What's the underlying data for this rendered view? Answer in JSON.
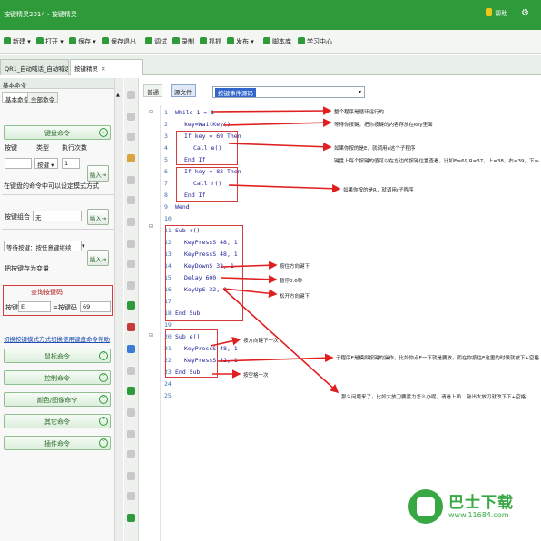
{
  "window": {
    "title": "按键精灵2014 - 按键精灵",
    "vip_label": "帮助",
    "min_icon": "minus-icon",
    "gear_icon": "gear-icon"
  },
  "toolbar": {
    "items": [
      {
        "label": "新建",
        "icon": "new-icon"
      },
      {
        "label": "打开",
        "icon": "open-icon"
      },
      {
        "label": "保存",
        "icon": "save-icon"
      },
      {
        "label": "保存退出",
        "icon": "save-exit-icon"
      },
      {
        "label": "调试",
        "icon": "debug-icon"
      },
      {
        "label": "录制",
        "icon": "record-icon"
      },
      {
        "label": "抓抓",
        "icon": "grab-icon"
      },
      {
        "label": "发布",
        "icon": "publish-icon"
      },
      {
        "label": "脚本库",
        "icon": "library-icon"
      },
      {
        "label": "学习中心",
        "icon": "learn-icon"
      }
    ]
  },
  "tabs": [
    {
      "label": "QR1_自动喊话_自动喊话...",
      "active": false
    },
    {
      "label": "按键精灵",
      "active": true
    }
  ],
  "left_panel": {
    "header": "基本命令",
    "tabs": [
      "基本命令",
      "全部命令"
    ],
    "keyboard_cmd": "键盘命令",
    "key_label": "按键",
    "type_label": "类型",
    "count_label": "执行次数",
    "type_value": "按键",
    "count_value": "1",
    "insert_label": "插入→",
    "hint_text": "在键盘的命令中可以设定模式方式",
    "combo_label": "按键组合",
    "combo_value": "无",
    "wait_label": "等待按键：按任意键继续",
    "sub_label": "把按键存为变量",
    "query_title": "查询按键码",
    "query_key_label": "按键",
    "query_key_value": "E",
    "query_code_label": "=按键码",
    "query_code_value": "69",
    "links": [
      "切换按键模式方式",
      "切换使用键盘命令",
      "帮助"
    ],
    "buttons": [
      "鼠标命令",
      "控制命令",
      "颜色/图像命令",
      "其它命令",
      "插件命令"
    ]
  },
  "editor": {
    "btn_normal": "普通",
    "btn_source": "源文件",
    "select_value": "按键事件源码",
    "lines": [
      {
        "n": "1",
        "code": "While 1 = 1"
      },
      {
        "n": "2",
        "code": "key=WaitKey()"
      },
      {
        "n": "3",
        "code": "If key = 69 Then"
      },
      {
        "n": "4",
        "code": "Call e()"
      },
      {
        "n": "5",
        "code": "End If"
      },
      {
        "n": "6",
        "code": "If key = 82 Then"
      },
      {
        "n": "7",
        "code": "Call r()"
      },
      {
        "n": "8",
        "code": "End If"
      },
      {
        "n": "9",
        "code": "Wend"
      },
      {
        "n": "10",
        "code": ""
      },
      {
        "n": "11",
        "code": "Sub r()"
      },
      {
        "n": "12",
        "code": "KeyPressS 48, 1"
      },
      {
        "n": "13",
        "code": "KeyPressS 48, 1"
      },
      {
        "n": "14",
        "code": "KeyDownS 32, 1"
      },
      {
        "n": "15",
        "code": "Delay 600"
      },
      {
        "n": "16",
        "code": "KeyUpS 32, 1"
      },
      {
        "n": "17",
        "code": ""
      },
      {
        "n": "18",
        "code": "End Sub"
      },
      {
        "n": "19",
        "code": ""
      },
      {
        "n": "20",
        "code": "Sub e()"
      },
      {
        "n": "21",
        "code": "KeyPressS 48, 1"
      },
      {
        "n": "22",
        "code": "KeyPressS 32, 1"
      },
      {
        "n": "23",
        "code": "End Sub"
      },
      {
        "n": "24",
        "code": ""
      },
      {
        "n": "25",
        "code": ""
      }
    ],
    "annotations": [
      "整个程序是循环运行的",
      "等待你按键，把你按键的内容存放在key里面",
      "如果你按的是E，就调用e这个子程序",
      "键盘上每个按键的值可以在左边的按键位置查看，比如E=69,R=37，上=38，右=39，下=40",
      "如果你按的是R，就调用r子程序",
      "按住方向键下",
      "暂停0.6秒",
      "松开方向键下",
      "按方向键下一次",
      "子程序E是模拟按键的操作，比如你点E一下就是要放。而在你按住E这里的时候就被下+空格",
      "按空格一次",
      "那么问题来了，比如大放刀要蓄力怎么办呢，请看上面",
      "敲出大放刀就改下下+空格"
    ]
  },
  "watermark": {
    "name": "巴士下载",
    "url": "www.11684.com"
  },
  "colors": {
    "brand_green": "#2e9a3a",
    "annotation_red": "#e02020",
    "keyword_blue": "#1e1e96"
  }
}
